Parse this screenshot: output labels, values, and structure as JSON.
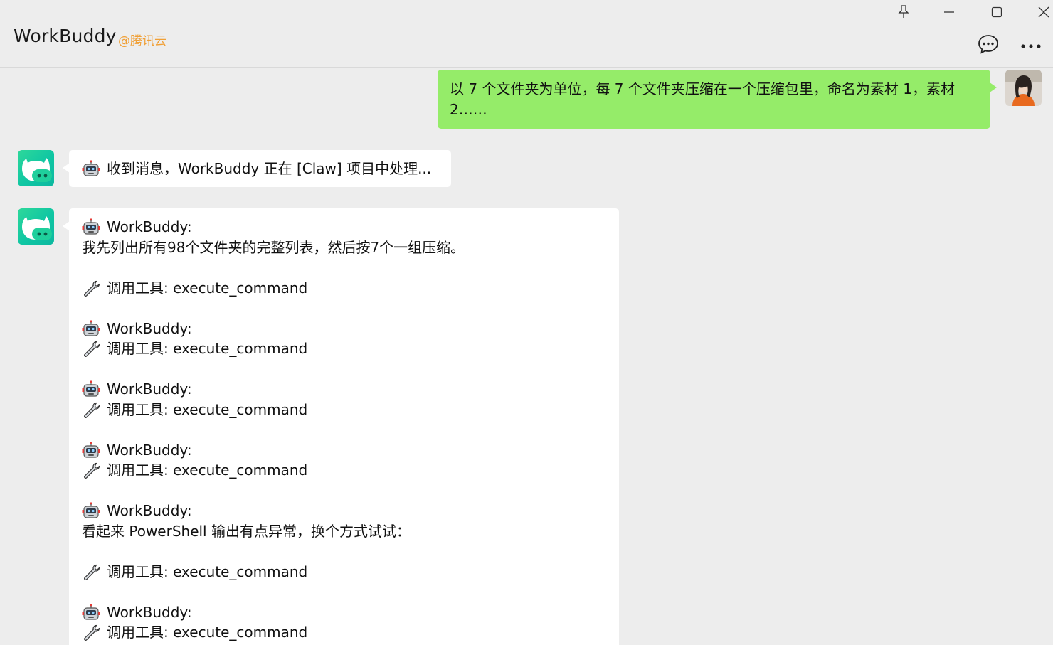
{
  "header": {
    "title": "WorkBuddy",
    "subtitle": "@腾讯云"
  },
  "icons": {
    "pin": "pin-icon",
    "minimize": "minimize-icon",
    "maximize": "maximize-icon",
    "close": "close-icon",
    "chat": "chat-bubble-icon",
    "more": "more-dots-icon",
    "robot": "robot-emoji-icon",
    "wrench": "wrench-emoji-icon"
  },
  "colors": {
    "accent": "#f0a037",
    "user_bubble": "#95ec69",
    "bot_avatar": "#1fcf9c",
    "background": "#ededed"
  },
  "messages": {
    "user": {
      "text": "以 7 个文件夹为单位，每 7 个文件夹压缩在一个压缩包里，命名为素材 1，素材 2……"
    },
    "bot1": {
      "text": "收到消息，WorkBuddy 正在 [Claw] 项目中处理..."
    },
    "bot2": {
      "lines": [
        "WorkBuddy:",
        "我先列出所有98个文件夹的完整列表，然后按7个一组压缩。",
        "调用工具: execute_command",
        "WorkBuddy:",
        "调用工具: execute_command",
        "WorkBuddy:",
        "调用工具: execute_command",
        "WorkBuddy:",
        "调用工具: execute_command",
        "WorkBuddy:",
        "看起来 PowerShell 输出有点异常，换个方式试试：",
        "调用工具: execute_command",
        "WorkBuddy:",
        "调用工具: execute_command"
      ]
    }
  }
}
